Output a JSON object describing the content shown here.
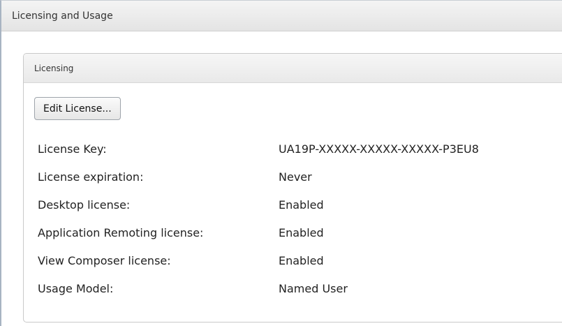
{
  "page": {
    "title": "Licensing and Usage"
  },
  "licensing_panel": {
    "title": "Licensing",
    "edit_button_label": "Edit License...",
    "rows": [
      {
        "label": "License Key:",
        "value": "UA19P-XXXXX-XXXXX-XXXXX-P3EU8"
      },
      {
        "label": "License expiration:",
        "value": "Never"
      },
      {
        "label": "Desktop license:",
        "value": "Enabled"
      },
      {
        "label": "Application Remoting license:",
        "value": "Enabled"
      },
      {
        "label": "View Composer license:",
        "value": "Enabled"
      },
      {
        "label": "Usage Model:",
        "value": "Named User"
      }
    ]
  }
}
